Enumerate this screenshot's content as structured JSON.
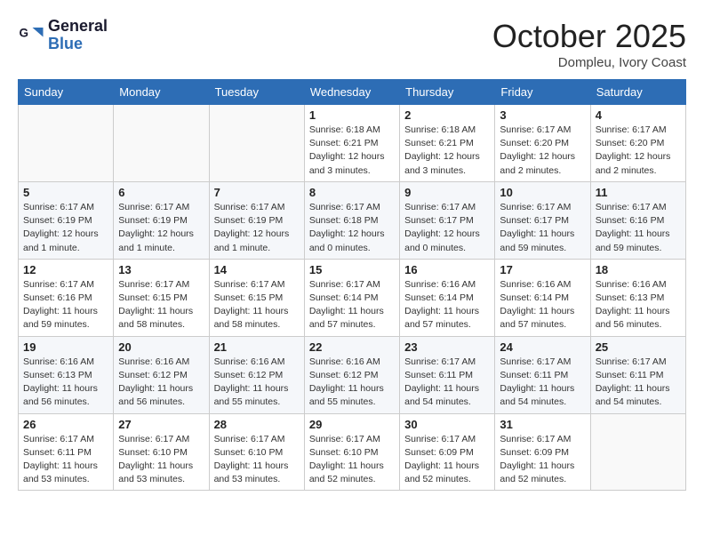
{
  "header": {
    "logo_line1": "General",
    "logo_line2": "Blue",
    "month": "October 2025",
    "location": "Dompleu, Ivory Coast"
  },
  "weekdays": [
    "Sunday",
    "Monday",
    "Tuesday",
    "Wednesday",
    "Thursday",
    "Friday",
    "Saturday"
  ],
  "weeks": [
    [
      {
        "day": "",
        "info": ""
      },
      {
        "day": "",
        "info": ""
      },
      {
        "day": "",
        "info": ""
      },
      {
        "day": "1",
        "info": "Sunrise: 6:18 AM\nSunset: 6:21 PM\nDaylight: 12 hours\nand 3 minutes."
      },
      {
        "day": "2",
        "info": "Sunrise: 6:18 AM\nSunset: 6:21 PM\nDaylight: 12 hours\nand 3 minutes."
      },
      {
        "day": "3",
        "info": "Sunrise: 6:17 AM\nSunset: 6:20 PM\nDaylight: 12 hours\nand 2 minutes."
      },
      {
        "day": "4",
        "info": "Sunrise: 6:17 AM\nSunset: 6:20 PM\nDaylight: 12 hours\nand 2 minutes."
      }
    ],
    [
      {
        "day": "5",
        "info": "Sunrise: 6:17 AM\nSunset: 6:19 PM\nDaylight: 12 hours\nand 1 minute."
      },
      {
        "day": "6",
        "info": "Sunrise: 6:17 AM\nSunset: 6:19 PM\nDaylight: 12 hours\nand 1 minute."
      },
      {
        "day": "7",
        "info": "Sunrise: 6:17 AM\nSunset: 6:19 PM\nDaylight: 12 hours\nand 1 minute."
      },
      {
        "day": "8",
        "info": "Sunrise: 6:17 AM\nSunset: 6:18 PM\nDaylight: 12 hours\nand 0 minutes."
      },
      {
        "day": "9",
        "info": "Sunrise: 6:17 AM\nSunset: 6:17 PM\nDaylight: 12 hours\nand 0 minutes."
      },
      {
        "day": "10",
        "info": "Sunrise: 6:17 AM\nSunset: 6:17 PM\nDaylight: 11 hours\nand 59 minutes."
      },
      {
        "day": "11",
        "info": "Sunrise: 6:17 AM\nSunset: 6:16 PM\nDaylight: 11 hours\nand 59 minutes."
      }
    ],
    [
      {
        "day": "12",
        "info": "Sunrise: 6:17 AM\nSunset: 6:16 PM\nDaylight: 11 hours\nand 59 minutes."
      },
      {
        "day": "13",
        "info": "Sunrise: 6:17 AM\nSunset: 6:15 PM\nDaylight: 11 hours\nand 58 minutes."
      },
      {
        "day": "14",
        "info": "Sunrise: 6:17 AM\nSunset: 6:15 PM\nDaylight: 11 hours\nand 58 minutes."
      },
      {
        "day": "15",
        "info": "Sunrise: 6:17 AM\nSunset: 6:14 PM\nDaylight: 11 hours\nand 57 minutes."
      },
      {
        "day": "16",
        "info": "Sunrise: 6:16 AM\nSunset: 6:14 PM\nDaylight: 11 hours\nand 57 minutes."
      },
      {
        "day": "17",
        "info": "Sunrise: 6:16 AM\nSunset: 6:14 PM\nDaylight: 11 hours\nand 57 minutes."
      },
      {
        "day": "18",
        "info": "Sunrise: 6:16 AM\nSunset: 6:13 PM\nDaylight: 11 hours\nand 56 minutes."
      }
    ],
    [
      {
        "day": "19",
        "info": "Sunrise: 6:16 AM\nSunset: 6:13 PM\nDaylight: 11 hours\nand 56 minutes."
      },
      {
        "day": "20",
        "info": "Sunrise: 6:16 AM\nSunset: 6:12 PM\nDaylight: 11 hours\nand 56 minutes."
      },
      {
        "day": "21",
        "info": "Sunrise: 6:16 AM\nSunset: 6:12 PM\nDaylight: 11 hours\nand 55 minutes."
      },
      {
        "day": "22",
        "info": "Sunrise: 6:16 AM\nSunset: 6:12 PM\nDaylight: 11 hours\nand 55 minutes."
      },
      {
        "day": "23",
        "info": "Sunrise: 6:17 AM\nSunset: 6:11 PM\nDaylight: 11 hours\nand 54 minutes."
      },
      {
        "day": "24",
        "info": "Sunrise: 6:17 AM\nSunset: 6:11 PM\nDaylight: 11 hours\nand 54 minutes."
      },
      {
        "day": "25",
        "info": "Sunrise: 6:17 AM\nSunset: 6:11 PM\nDaylight: 11 hours\nand 54 minutes."
      }
    ],
    [
      {
        "day": "26",
        "info": "Sunrise: 6:17 AM\nSunset: 6:11 PM\nDaylight: 11 hours\nand 53 minutes."
      },
      {
        "day": "27",
        "info": "Sunrise: 6:17 AM\nSunset: 6:10 PM\nDaylight: 11 hours\nand 53 minutes."
      },
      {
        "day": "28",
        "info": "Sunrise: 6:17 AM\nSunset: 6:10 PM\nDaylight: 11 hours\nand 53 minutes."
      },
      {
        "day": "29",
        "info": "Sunrise: 6:17 AM\nSunset: 6:10 PM\nDaylight: 11 hours\nand 52 minutes."
      },
      {
        "day": "30",
        "info": "Sunrise: 6:17 AM\nSunset: 6:09 PM\nDaylight: 11 hours\nand 52 minutes."
      },
      {
        "day": "31",
        "info": "Sunrise: 6:17 AM\nSunset: 6:09 PM\nDaylight: 11 hours\nand 52 minutes."
      },
      {
        "day": "",
        "info": ""
      }
    ]
  ]
}
